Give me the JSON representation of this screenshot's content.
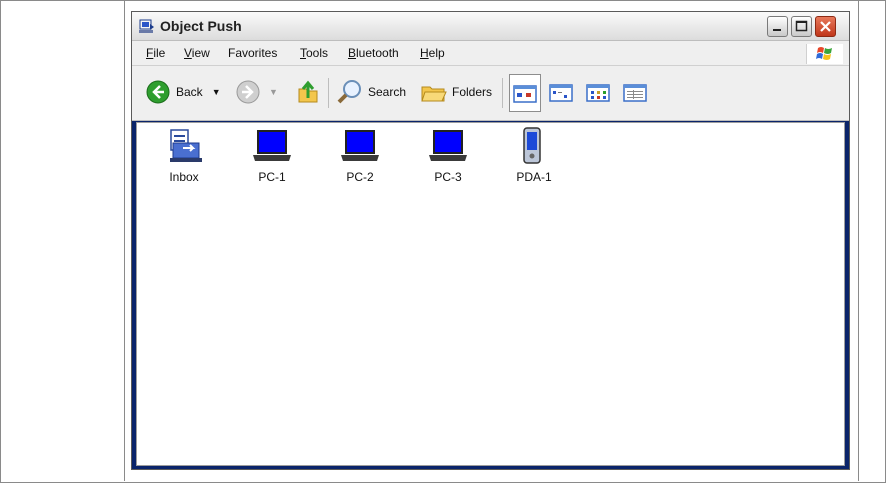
{
  "window": {
    "title": "Object Push",
    "menu": [
      {
        "label_ul": "F",
        "label_rest": "ile"
      },
      {
        "label_ul": "V",
        "label_rest": "iew"
      },
      {
        "label_ul": "",
        "label_rest": "Favorites"
      },
      {
        "label_ul": "T",
        "label_rest": "ools"
      },
      {
        "label_ul": "B",
        "label_rest": "luetooth"
      },
      {
        "label_ul": "H",
        "label_rest": "elp"
      }
    ],
    "toolbar": {
      "back_label": "Back",
      "search_label": "Search",
      "folders_label": "Folders"
    }
  },
  "items": [
    {
      "label": "Inbox",
      "icon": "inbox-icon"
    },
    {
      "label": "PC-1",
      "icon": "laptop-icon"
    },
    {
      "label": "PC-2",
      "icon": "laptop-icon"
    },
    {
      "label": "PC-3",
      "icon": "laptop-icon"
    },
    {
      "label": "PDA-1",
      "icon": "pda-icon"
    }
  ],
  "colors": {
    "laptop_screen": "#0000ff",
    "close_button": "#d2452a",
    "back_green": "#2f9e2f"
  }
}
